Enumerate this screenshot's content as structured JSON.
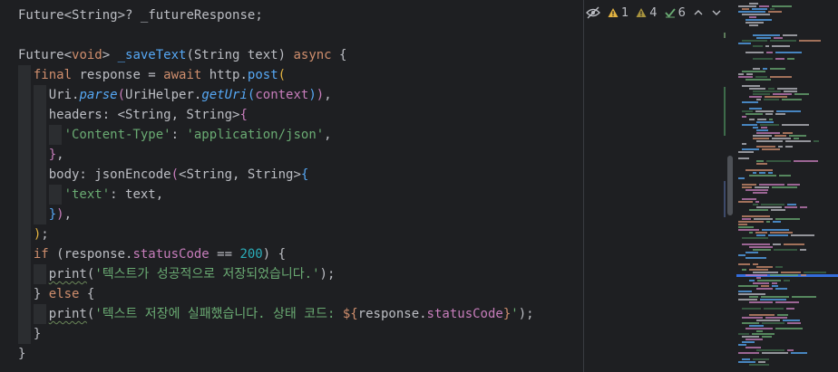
{
  "editor": {
    "lines": [
      [
        {
          "t": "Future",
          "c": "typ"
        },
        {
          "t": "<",
          "c": "typ"
        },
        {
          "t": "String",
          "c": "typ"
        },
        {
          "t": ">? ",
          "c": "typ"
        },
        {
          "t": "_futureResponse",
          "c": "typ"
        },
        {
          "t": ";",
          "c": "typ"
        }
      ],
      [],
      [
        {
          "t": "Future",
          "c": "typ"
        },
        {
          "t": "<",
          "c": "typ"
        },
        {
          "t": "void",
          "c": "kw"
        },
        {
          "t": "> ",
          "c": "typ"
        },
        {
          "t": "_saveText",
          "c": "fn"
        },
        {
          "t": "(String text) ",
          "c": "typ"
        },
        {
          "t": "async",
          "c": "kw"
        },
        {
          "t": " {",
          "c": "typ"
        }
      ],
      [
        {
          "t": "  ",
          "c": "typ"
        },
        {
          "t": "final",
          "c": "kw"
        },
        {
          "t": " response = ",
          "c": "typ"
        },
        {
          "t": "await",
          "c": "kw"
        },
        {
          "t": " http.",
          "c": "typ"
        },
        {
          "t": "post",
          "c": "fn"
        },
        {
          "t": "(",
          "c": "brace1"
        }
      ],
      [
        {
          "t": "    Uri.",
          "c": "typ"
        },
        {
          "t": "parse",
          "c": "it"
        },
        {
          "t": "(",
          "c": "brace2"
        },
        {
          "t": "UriHelper.",
          "c": "typ"
        },
        {
          "t": "getUri",
          "c": "it"
        },
        {
          "t": "(",
          "c": "brace3"
        },
        {
          "t": "context",
          "c": "field"
        },
        {
          "t": ")",
          "c": "brace3"
        },
        {
          "t": ")",
          "c": "brace2"
        },
        {
          "t": ",",
          "c": "typ"
        }
      ],
      [
        {
          "t": "    headers: <String, String>",
          "c": "typ"
        },
        {
          "t": "{",
          "c": "brace2"
        }
      ],
      [
        {
          "t": "      ",
          "c": "typ"
        },
        {
          "t": "'Content-Type'",
          "c": "str"
        },
        {
          "t": ": ",
          "c": "typ"
        },
        {
          "t": "'application/json'",
          "c": "str"
        },
        {
          "t": ",",
          "c": "typ"
        }
      ],
      [
        {
          "t": "    ",
          "c": "typ"
        },
        {
          "t": "}",
          "c": "brace2"
        },
        {
          "t": ",",
          "c": "typ"
        }
      ],
      [
        {
          "t": "    body: ",
          "c": "typ"
        },
        {
          "t": "jsonEncode",
          "c": "typ"
        },
        {
          "t": "(",
          "c": "brace2"
        },
        {
          "t": "<String, String>",
          "c": "typ"
        },
        {
          "t": "{",
          "c": "brace3"
        }
      ],
      [
        {
          "t": "      ",
          "c": "typ"
        },
        {
          "t": "'text'",
          "c": "str"
        },
        {
          "t": ": text,",
          "c": "typ"
        }
      ],
      [
        {
          "t": "    ",
          "c": "typ"
        },
        {
          "t": "}",
          "c": "brace3"
        },
        {
          "t": ")",
          "c": "brace2"
        },
        {
          "t": ",",
          "c": "typ"
        }
      ],
      [
        {
          "t": "  ",
          "c": "typ"
        },
        {
          "t": ")",
          "c": "brace1"
        },
        {
          "t": ";",
          "c": "typ"
        }
      ],
      [
        {
          "t": "  ",
          "c": "typ"
        },
        {
          "t": "if",
          "c": "kw"
        },
        {
          "t": " (response.",
          "c": "typ"
        },
        {
          "t": "statusCode",
          "c": "field"
        },
        {
          "t": " == ",
          "c": "typ"
        },
        {
          "t": "200",
          "c": "num"
        },
        {
          "t": ") {",
          "c": "typ"
        }
      ],
      [
        {
          "t": "    ",
          "c": "typ"
        },
        {
          "t": "print",
          "c": "squig"
        },
        {
          "t": "(",
          "c": "typ"
        },
        {
          "t": "'텍스트가 성공적으로 저장되었습니다.'",
          "c": "str"
        },
        {
          "t": ");",
          "c": "typ"
        }
      ],
      [
        {
          "t": "  } ",
          "c": "typ"
        },
        {
          "t": "else",
          "c": "kw"
        },
        {
          "t": " {",
          "c": "typ"
        }
      ],
      [
        {
          "t": "    ",
          "c": "typ"
        },
        {
          "t": "print",
          "c": "squig"
        },
        {
          "t": "(",
          "c": "typ"
        },
        {
          "t": "'텍스트 저장에 실패했습니다. 상태 코드: ",
          "c": "str"
        },
        {
          "t": "${",
          "c": "kw"
        },
        {
          "t": "response.",
          "c": "typ"
        },
        {
          "t": "statusCode",
          "c": "field"
        },
        {
          "t": "}",
          "c": "kw"
        },
        {
          "t": "'",
          "c": "str"
        },
        {
          "t": ");",
          "c": "typ"
        }
      ],
      [
        {
          "t": "  }",
          "c": "typ"
        }
      ],
      [
        {
          "t": "}",
          "c": "typ"
        }
      ]
    ],
    "indent_guides": [
      {
        "line": 3,
        "depth": 1
      },
      {
        "line": 4,
        "depth": 2
      },
      {
        "line": 5,
        "depth": 2
      },
      {
        "line": 6,
        "depth": 3
      },
      {
        "line": 7,
        "depth": 2
      },
      {
        "line": 8,
        "depth": 2
      },
      {
        "line": 9,
        "depth": 3
      },
      {
        "line": 10,
        "depth": 2
      },
      {
        "line": 11,
        "depth": 1
      },
      {
        "line": 12,
        "depth": 1
      },
      {
        "line": 13,
        "depth": 2
      },
      {
        "line": 14,
        "depth": 1
      },
      {
        "line": 15,
        "depth": 2
      },
      {
        "line": 16,
        "depth": 1
      }
    ]
  },
  "inspections": {
    "hidden_icon": "eye-slash-icon",
    "warnings_label": "1",
    "weak_warnings_label": "4",
    "typos_label": "6",
    "colors": {
      "warning": "#e3b341",
      "weak": "#b8a04a",
      "typo": "#6aab73"
    }
  }
}
